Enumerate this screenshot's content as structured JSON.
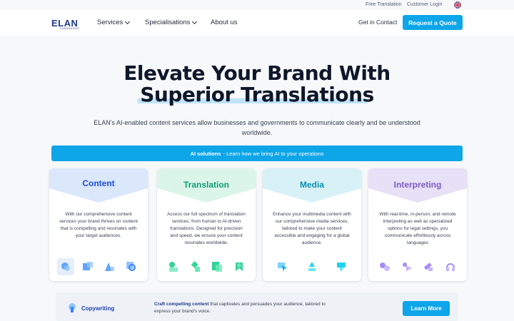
{
  "topbar": {
    "free_translation": "Free Translation",
    "customer_login": "Customer Login"
  },
  "nav": {
    "logo_text": "ELAN",
    "logo_sub": "LANGUAGES",
    "services": "Services",
    "specialisations": "Specialisations",
    "about": "About us",
    "contact": "Get in Contact",
    "quote": "Request a Quote"
  },
  "hero": {
    "title_line1": "Elevate Your Brand With",
    "title_line2": "Superior Translations",
    "subtitle": "ELAN's AI-enabled content services allow businesses and governments to communicate clearly and be understood worldwide."
  },
  "ai_bar": {
    "bold": "AI solutions",
    "text": "- Learn how we bring AI to your operations"
  },
  "cards": [
    {
      "title": "Content",
      "color": "#1d4ed8",
      "bg": "#dbe7fb",
      "desc": "With our comprehensive content services your brand thrives on content that is compelling and resonates with your target audiences."
    },
    {
      "title": "Translation",
      "color": "#0f9d74",
      "bg": "#dcf5ea",
      "desc": "Access our full spectrum of translation services, from human to AI-driven translations. Designed for precision and speed, we ensure your content resonates worldwide."
    },
    {
      "title": "Media",
      "color": "#0891b2",
      "bg": "#d8f1f7",
      "desc": "Enhance your multimedia content with our comprehensive media services, tailored to make your content accessible and engaging for a global audience."
    },
    {
      "title": "Interpreting",
      "color": "#7c5cc4",
      "bg": "#e7e0f6",
      "desc": "With real-time, in-person, and remote interpreting as well as specialized options for legal settings, you communicate effortlessly across languages"
    }
  ],
  "copywriting": {
    "label": "Copywriting",
    "bold": "Craft compelling content",
    "text": " that captivates and persuades your audience, tailored to express your brand's voice.",
    "button": "Learn More"
  }
}
